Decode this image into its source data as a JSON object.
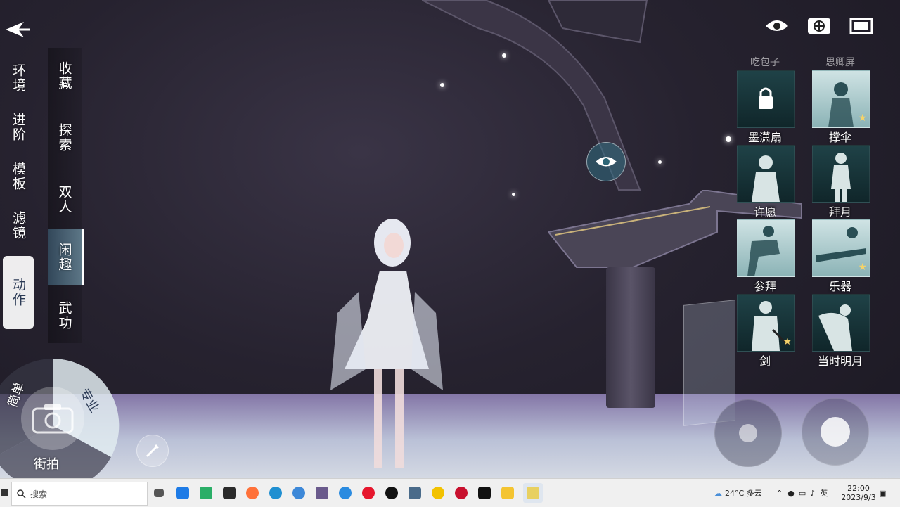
{
  "nav_primary": [
    "环境",
    "进阶",
    "模板",
    "滤镜",
    "动作"
  ],
  "nav_primary_active": "动作",
  "nav_secondary": [
    "收藏",
    "探索",
    "双人",
    "闲趣",
    "武功"
  ],
  "nav_secondary_active": "闲趣",
  "dial": {
    "simple": "简单",
    "pro": "专业",
    "street": "街拍"
  },
  "grid_headers": [
    "吃包子",
    "思卿屏"
  ],
  "actions": [
    {
      "label": "墨潇扇",
      "locked": true
    },
    {
      "label": "撑伞",
      "starred": true
    },
    {
      "label": "许愿"
    },
    {
      "label": "拜月"
    },
    {
      "label": "参拜"
    },
    {
      "label": "乐器",
      "starred": true
    },
    {
      "label": "剑",
      "starred": true
    },
    {
      "label": "当时明月"
    }
  ],
  "taskbar": {
    "search_placeholder": "搜索",
    "weather": "24°C 多云",
    "ime": "英",
    "time": "22:00",
    "date": "2023/9/3"
  },
  "colors": {
    "accent": "#5b8fa8",
    "active_tab_bg": "#ffffff",
    "active_tab_text": "#2b3a55"
  }
}
